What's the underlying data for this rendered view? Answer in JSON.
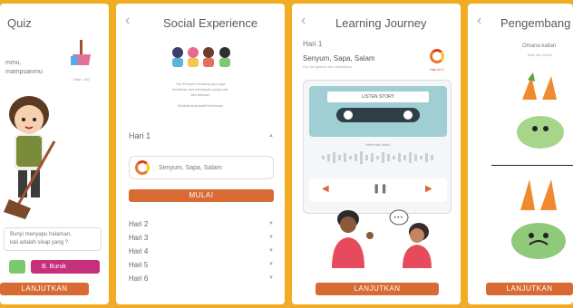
{
  "screen1": {
    "title": "Quiz",
    "prompt_line1": "mmu,",
    "prompt_line2": "mampuanmu",
    "score": "Nilai : 100",
    "question_line1": "Bunyi menyapu halaman,",
    "question_line2": "kali adalah sikap yang ?",
    "option_b": "B. Buruk",
    "continue": "LANJUTKAN"
  },
  "screen2": {
    "title": "Social Experience",
    "desc_line1": "Yuk Pahami bersama apa saja",
    "desc_line2": "kebaikan dan kebiasaan yang baik",
    "desc_line3": "kita lakukan",
    "tag": "#KebaikanAdalahKebiasaan",
    "day1": "Hari 1",
    "lesson": "Senyum, Sapa, Salam",
    "start": "MULAI",
    "days": [
      "Hari 2",
      "Hari 3",
      "Hari 4",
      "Hari 5",
      "Hari 6"
    ]
  },
  "screen3": {
    "title": "Learning Journey",
    "day": "Hari 1",
    "lesson": "Senyum, Sapa, Salam",
    "sub": "Ayo dengarkan dan praktikkan",
    "badge": "Hari ke 1",
    "tape_label": "LISTEN STORY",
    "status": "Memutar audio",
    "continue": "LANJUTKAN"
  },
  "screen4": {
    "title": "Pengembang",
    "subtitle_line1": "Omana kaitan",
    "subtitle_line2": "Baik dan benar",
    "continue": "LANJUTKAN"
  }
}
